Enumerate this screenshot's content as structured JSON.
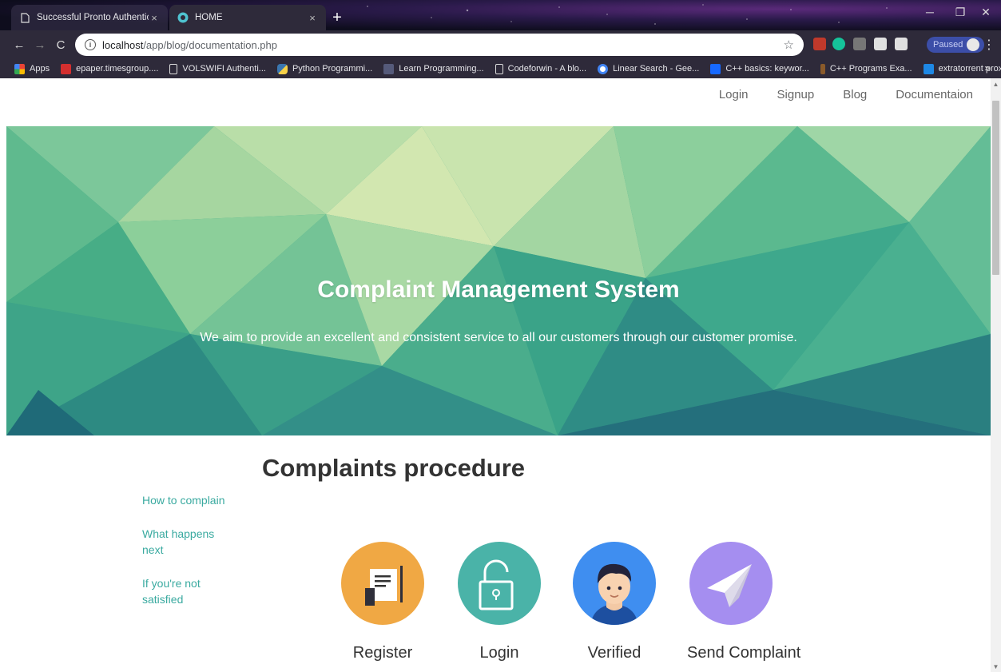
{
  "browser": {
    "tabs": [
      {
        "title": "Successful Pronto Authentication",
        "active": false
      },
      {
        "title": "HOME",
        "active": true
      }
    ],
    "url_host": "localhost",
    "url_path": "/app/blog/documentation.php",
    "profile_status": "Paused",
    "bookmarks": [
      {
        "label": "Apps",
        "icon": "apps-grid-icon"
      },
      {
        "label": "epaper.timesgroup....",
        "icon": "epaper-icon"
      },
      {
        "label": "VOLSWIFI Authenti...",
        "icon": "page-icon"
      },
      {
        "label": "Python Programmi...",
        "icon": "python-icon"
      },
      {
        "label": "Learn Programming...",
        "icon": "learn-icon"
      },
      {
        "label": "Codeforwin - A blo...",
        "icon": "page-icon"
      },
      {
        "label": "Linear Search - Gee...",
        "icon": "google-icon"
      },
      {
        "label": "C++ basics: keywor...",
        "icon": "behance-icon"
      },
      {
        "label": "C++ Programs Exa...",
        "icon": "cpp-icon"
      },
      {
        "label": "extratorrent proxy -...",
        "icon": "is-icon"
      }
    ],
    "bookmarks_more": "»"
  },
  "nav": {
    "login": "Login",
    "signup": "Signup",
    "blog": "Blog",
    "documentation": "Documentaion"
  },
  "hero": {
    "title": "Complaint Management System",
    "subtitle": "We aim to provide an excellent and consistent service to all our customers through our customer promise."
  },
  "procedure": {
    "title": "Complaints procedure",
    "links": [
      "How to complain",
      "What happens next",
      "If you're not satisfied"
    ],
    "steps": [
      {
        "label": "Register",
        "icon": "register-document-icon",
        "color": "#f0a844"
      },
      {
        "label": "Login",
        "icon": "unlock-padlock-icon",
        "color": "#4ab3a8"
      },
      {
        "label": "Verified",
        "icon": "user-avatar-icon",
        "color": "#3f8ef0"
      },
      {
        "label": "Send Complaint",
        "icon": "paper-plane-icon",
        "color": "#a58ef0"
      }
    ]
  }
}
